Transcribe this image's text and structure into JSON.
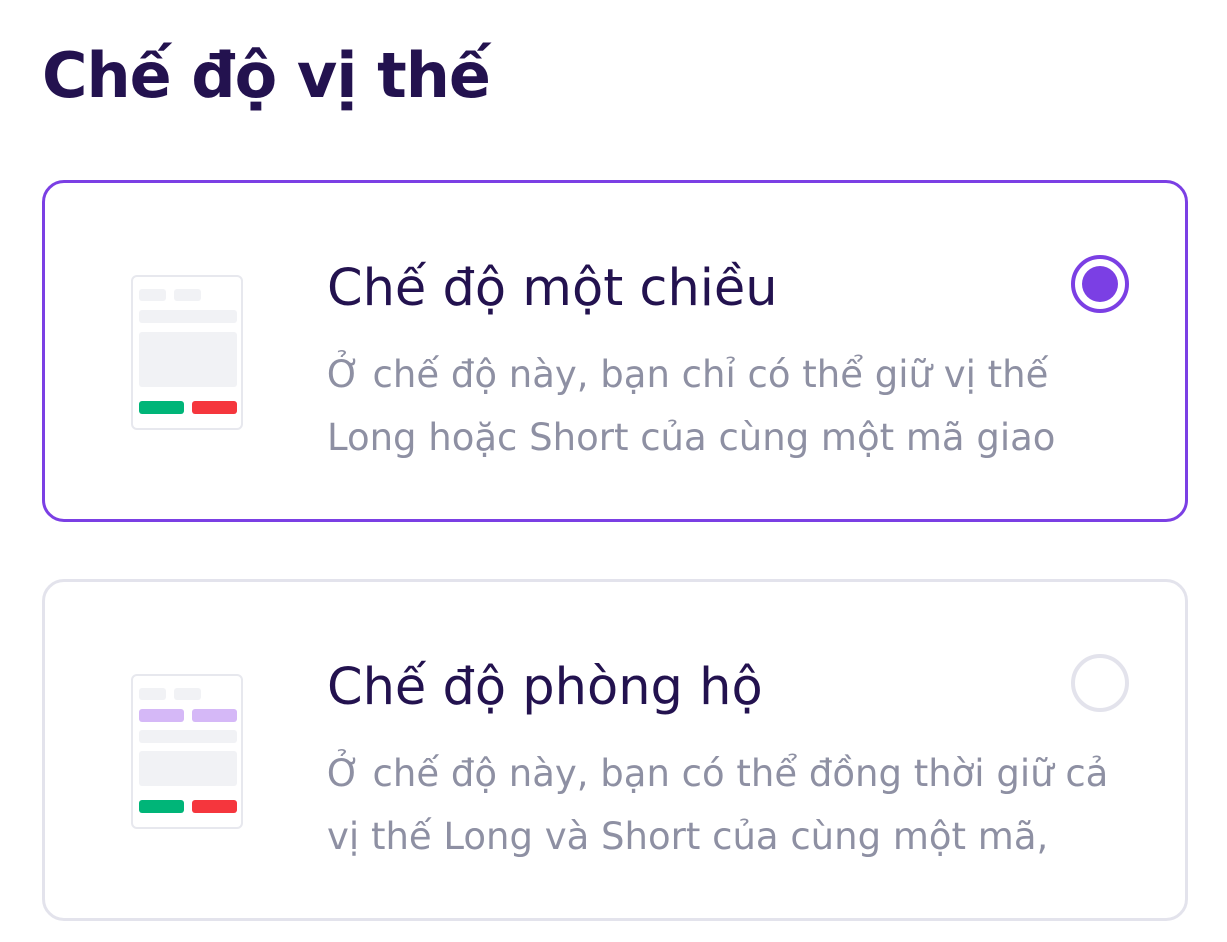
{
  "header": {
    "title": "Chế độ vị thế"
  },
  "options": [
    {
      "title": "Chế độ một chiều",
      "desc_line1": "Ở chế độ này, bạn chỉ có thể giữ vị thế",
      "desc_line2": "Long hoặc Short của cùng một mã giao",
      "selected": true
    },
    {
      "title": "Chế độ phòng hộ",
      "desc_line1": "Ở chế độ này, bạn có thể đồng thời giữ cả",
      "desc_line2": "vị thế Long và Short của cùng một mã,",
      "selected": false
    }
  ],
  "colors": {
    "accent": "#7b3fe4",
    "title_text": "#23124f",
    "desc_text": "#8e90a3",
    "buy_green": "#00b578",
    "sell_red": "#f5363d",
    "hedge_purple": "#d5b8f7"
  },
  "icons": {
    "one_way_illustration": "one-way-mode-illustration-icon",
    "hedge_illustration": "hedge-mode-illustration-icon"
  }
}
